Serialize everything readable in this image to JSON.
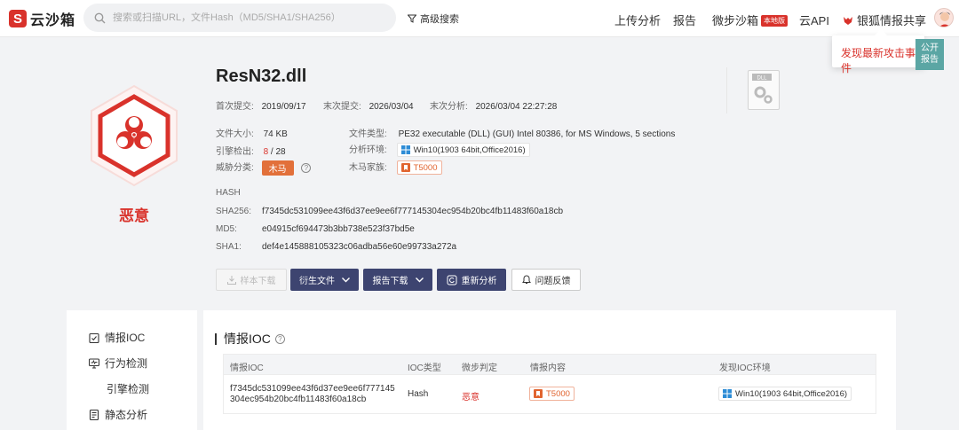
{
  "header": {
    "logo_mark": "S",
    "logo_text": "云沙箱",
    "search_placeholder": "搜索或扫描URL，文件Hash（MD5/SHA1/SHA256）",
    "advanced_search": "高级搜索",
    "nav": {
      "upload": "上传分析",
      "report": "报告",
      "micro_sandbox": "微步沙箱",
      "micro_sandbox_badge": "本地版",
      "cloud_api": "云API",
      "share": "银狐情报共享"
    }
  },
  "tooltip": {
    "text": "发现最新攻击事件"
  },
  "side_tab": {
    "line1": "公开",
    "line2": "报告"
  },
  "summary": {
    "verdict": "恶意",
    "file_name": "ResN32.dll",
    "first_submit_label": "首次提交:",
    "first_submit": "2019/09/17",
    "last_submit_label": "末次提交:",
    "last_submit": "2026/03/04",
    "last_analysis_label": "末次分析:",
    "last_analysis": "2026/03/04 22:27:28",
    "size_label": "文件大小:",
    "size": "74 KB",
    "engine_label": "引擎检出:",
    "engine_detected": "8",
    "engine_sep": " / ",
    "engine_total": "28",
    "threat_label": "威胁分类:",
    "threat_tag": "木马",
    "file_type_label": "文件类型:",
    "file_type": "PE32 executable (DLL) (GUI) Intel 80386, for MS Windows, 5 sections",
    "env_label": "分析环境:",
    "env": "Win10(1903 64bit,Office2016)",
    "family_label": "木马家族:",
    "family": "T5000",
    "dll_icon_label": "DLL",
    "hash_heading": "HASH",
    "sha256_label": "SHA256:",
    "sha256": "f7345dc531099ee43f6d37ee9ee6f777145304ec954b20bc4fb11483f60a18cb",
    "md5_label": "MD5:",
    "md5": "e04915cf694473b3bb738e523f37bd5e",
    "sha1_label": "SHA1:",
    "sha1": "def4e145888105323c06adba56e60e99733a272a"
  },
  "actions": {
    "download_sample": "样本下载",
    "derived_files": "衍生文件",
    "report_download": "报告下载",
    "reanalyze": "重新分析",
    "feedback": "问题反馈"
  },
  "sidebar": {
    "items": [
      {
        "label": "情报IOC"
      },
      {
        "label": "行为检测"
      },
      {
        "label": "引擎检测"
      },
      {
        "label": "静态分析"
      }
    ]
  },
  "ioc": {
    "title": "情报IOC",
    "columns": [
      "情报IOC",
      "IOC类型",
      "微步判定",
      "情报内容",
      "发现IOC环境"
    ],
    "rows": [
      {
        "ioc_line1": "f7345dc531099ee43f6d37ee9ee6f777145",
        "ioc_line2": "304ec954b20bc4fb11483f60a18cb",
        "type": "Hash",
        "verdict": "恶意",
        "content": "T5000",
        "env": "Win10(1903 64bit,Office2016)"
      }
    ]
  },
  "colors": {
    "brand_red": "#d9322b",
    "dark_button": "#3d4470",
    "trojan_orange": "#e2703a",
    "side_tab": "#5ba6a4"
  }
}
